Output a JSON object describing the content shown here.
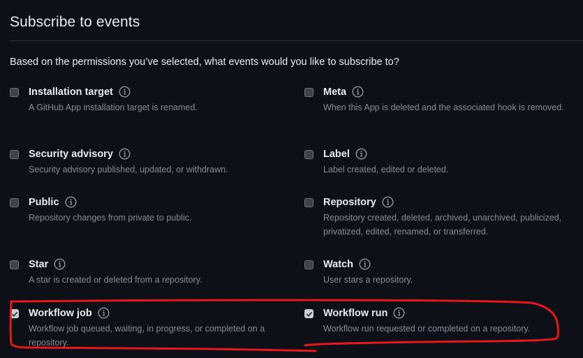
{
  "header": {
    "title": "Subscribe to events",
    "intro": "Based on the permissions you’ve selected, what events would you like to subscribe to?"
  },
  "events": [
    {
      "name": "Installation target",
      "description": "A GitHub App installation target is renamed.",
      "checked": false
    },
    {
      "name": "Meta",
      "description": "When this App is deleted and the associated hook is removed.",
      "checked": false
    },
    {
      "name": "Security advisory",
      "description": "Security advisory published, updated, or withdrawn.",
      "checked": false
    },
    {
      "name": "Label",
      "description": "Label created, edited or deleted.",
      "checked": false
    },
    {
      "name": "Public",
      "description": "Repository changes from private to public.",
      "checked": false
    },
    {
      "name": "Repository",
      "description": "Repository created, deleted, archived, unarchived, publicized, privatized, edited, renamed, or transferred.",
      "checked": false
    },
    {
      "name": "Star",
      "description": "A star is created or deleted from a repository.",
      "checked": false
    },
    {
      "name": "Watch",
      "description": "User stars a repository.",
      "checked": false
    },
    {
      "name": "Workflow job",
      "description": "Workflow job queued, waiting, in progress, or completed on a repository.",
      "checked": true
    },
    {
      "name": "Workflow run",
      "description": "Workflow run requested or completed on a repository.",
      "checked": true
    }
  ],
  "icons": {
    "info": "info-icon",
    "check": "check-icon"
  },
  "colors": {
    "background": "#0d1117",
    "text": "#e6edf3",
    "muted": "#848d97",
    "annotation": "#e5191c"
  }
}
